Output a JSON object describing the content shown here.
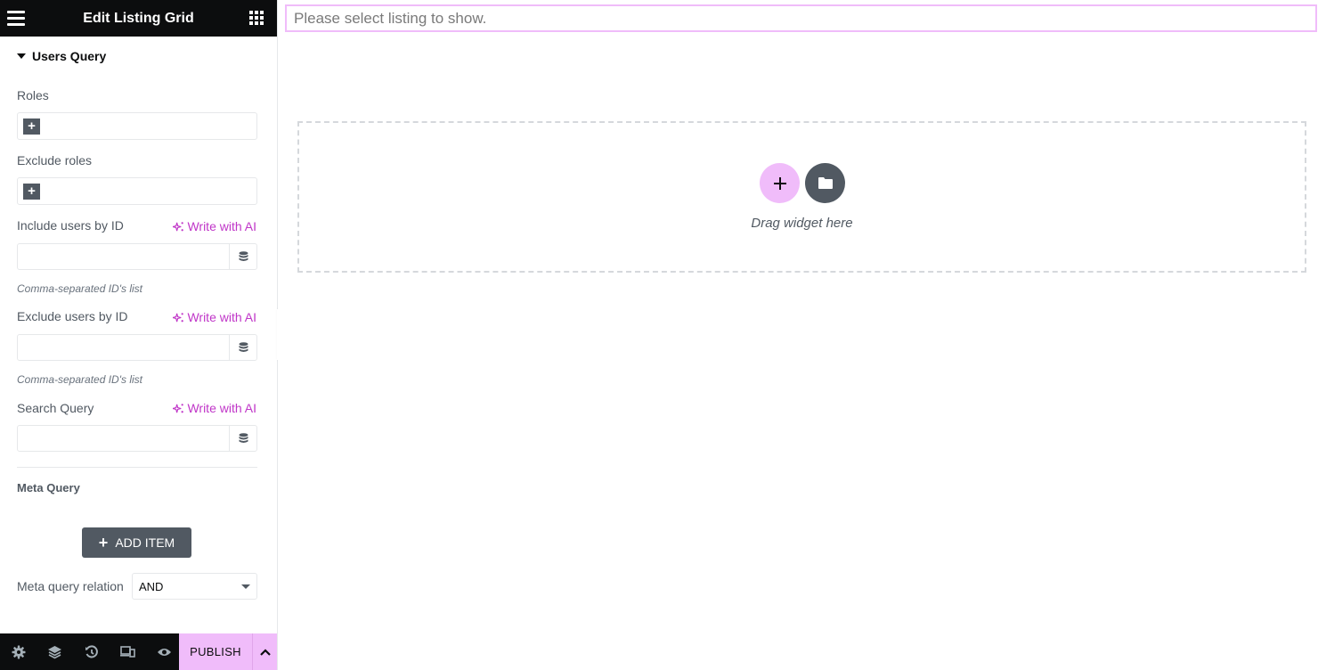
{
  "header": {
    "title": "Edit Listing Grid",
    "menu_icon": "hamburger-icon",
    "widgets_icon": "grid-icon"
  },
  "section": {
    "title": "Users Query",
    "fields": {
      "roles": {
        "label": "Roles"
      },
      "exclude_roles": {
        "label": "Exclude roles"
      },
      "include_users": {
        "label": "Include users by ID",
        "ai_label": "Write with AI",
        "value": "",
        "hint": "Comma-separated ID's list"
      },
      "exclude_users": {
        "label": "Exclude users by ID",
        "ai_label": "Write with AI",
        "value": "",
        "hint": "Comma-separated ID's list"
      },
      "search_query": {
        "label": "Search Query",
        "ai_label": "Write with AI",
        "value": ""
      }
    },
    "meta_query": {
      "title": "Meta Query",
      "add_item_label": "ADD ITEM",
      "relation_label": "Meta query relation",
      "relation_value": "AND"
    }
  },
  "footer": {
    "publish_label": "PUBLISH",
    "icons": [
      "settings-icon",
      "layers-icon",
      "history-icon",
      "responsive-icon",
      "preview-icon"
    ]
  },
  "canvas": {
    "notice": "Please select listing to show.",
    "dropzone_text": "Drag widget here"
  },
  "colors": {
    "accent": "#f0bcfa",
    "ai_link": "#c036c8",
    "dark": "#0c0d0e",
    "secondary": "#515962"
  }
}
